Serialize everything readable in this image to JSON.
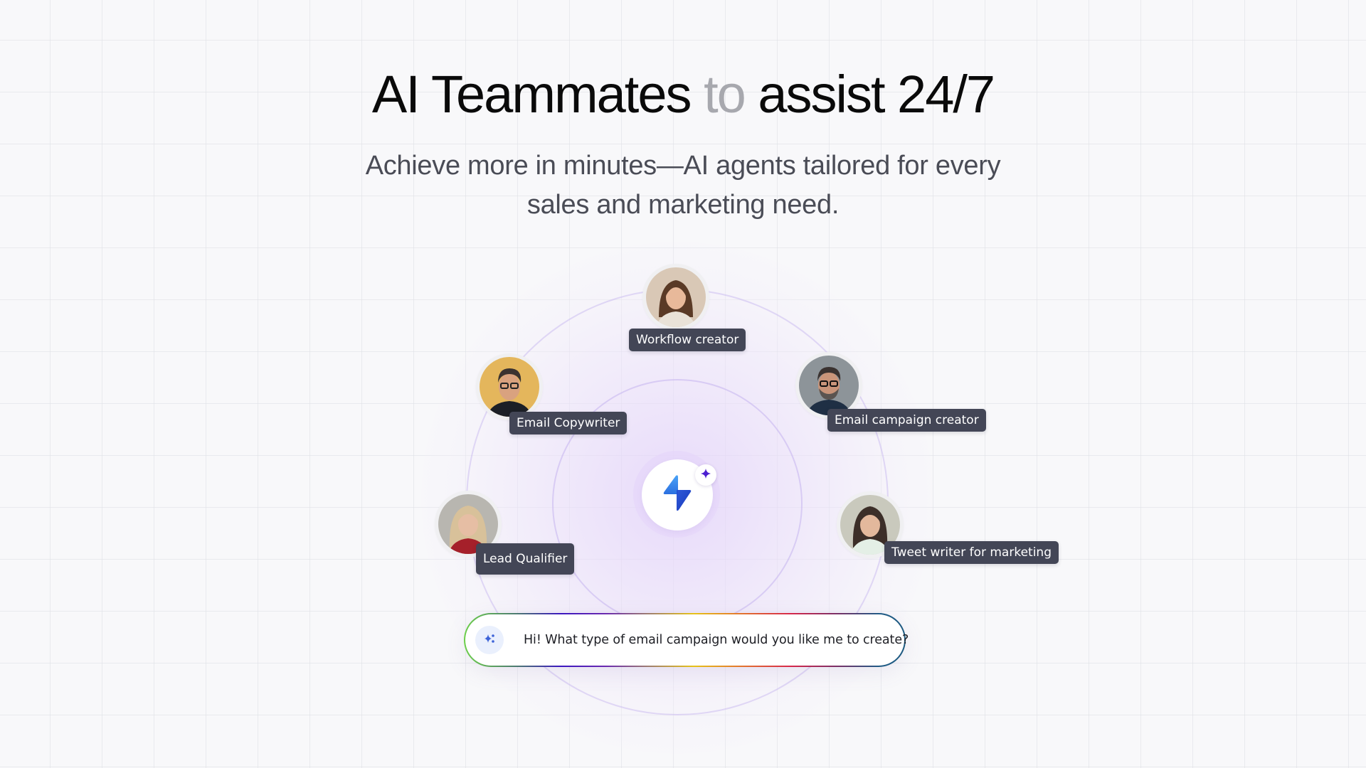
{
  "hero": {
    "title_part1": "AI Teammates",
    "title_muted": "to",
    "title_part2": "assist 24/7",
    "subtitle_line1": "Achieve more in minutes—AI agents tailored for every",
    "subtitle_line2": "sales and marketing need."
  },
  "center": {
    "logo_icon": "lightning-bolt-icon",
    "badge_icon": "sparkle-icon"
  },
  "agents": [
    {
      "label": "Workflow creator",
      "avatar_bg": "#d9c8b6",
      "icon": "avatar-woman-brown-hair"
    },
    {
      "label": "Email Copywriter",
      "avatar_bg": "#e4b65c",
      "icon": "avatar-man-glasses"
    },
    {
      "label": "Email campaign creator",
      "avatar_bg": "#8d9499",
      "icon": "avatar-man-beard-glasses"
    },
    {
      "label": "Lead Qualifier",
      "avatar_bg": "#b8b6b0",
      "icon": "avatar-woman-blonde"
    },
    {
      "label": "Tweet writer for marketing",
      "avatar_bg": "#c9c9bd",
      "icon": "avatar-woman-dark-hair"
    }
  ],
  "chat": {
    "icon": "ai-sparkle-icon",
    "message": "Hi! What type of email campaign would you like me to create?"
  },
  "colors": {
    "label_bg": "#434656",
    "title": "#0a0a0a",
    "title_muted": "#a7a8ae",
    "subtitle": "#4a4c56",
    "accent_blue": "#2563eb",
    "sparkle_purple": "#4c1fd1"
  }
}
